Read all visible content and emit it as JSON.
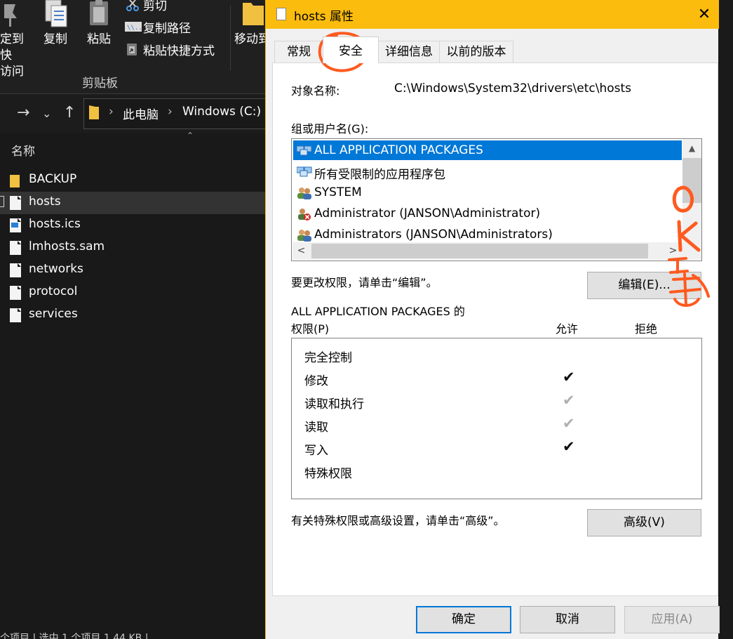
{
  "explorer": {
    "ribbon": {
      "pin_label": "定到快\n访问",
      "copy_label": "复制",
      "paste_label": "粘贴",
      "cut_label": "剪切",
      "copy_path_label": "复制路径",
      "paste_shortcut_label": "粘贴快捷方式",
      "move_label": "移动到",
      "group_label": "剪贴板"
    },
    "breadcrumb": [
      "此电脑",
      "Windows (C:)"
    ],
    "column_header": "名称",
    "files": [
      {
        "name": "BACKUP",
        "type": "folder"
      },
      {
        "name": "hosts",
        "type": "file",
        "selected": true
      },
      {
        "name": "hosts.ics",
        "type": "ics"
      },
      {
        "name": "lmhosts.sam",
        "type": "file"
      },
      {
        "name": "networks",
        "type": "file"
      },
      {
        "name": "protocol",
        "type": "file"
      },
      {
        "name": "services",
        "type": "file"
      }
    ],
    "status": "个项目  |  选中 1 个项目  1.44 KB  |"
  },
  "dialog": {
    "title": "hosts 属性",
    "close_label": "✕",
    "tabs": [
      "常规",
      "安全",
      "详细信息",
      "以前的版本"
    ],
    "active_tab": "安全",
    "object_name_label": "对象名称:",
    "object_name_value": "C:\\Windows\\System32\\drivers\\etc\\hosts",
    "groups_label": "组或用户名(G):",
    "groups": [
      {
        "name": "ALL APPLICATION PACKAGES",
        "icon": "app-packages-icon",
        "selected": true
      },
      {
        "name": "所有受限制的应用程序包",
        "icon": "app-packages-icon"
      },
      {
        "name": "SYSTEM",
        "icon": "users-group-icon"
      },
      {
        "name": "Administrator (JANSON\\Administrator)",
        "icon": "user-disabled-icon"
      },
      {
        "name": "Administrators (JANSON\\Administrators)",
        "icon": "users-group-icon"
      }
    ],
    "edit_hint": "要更改权限，请单击“编辑”。",
    "edit_button": "编辑(E)...",
    "perm_title_line1": "ALL APPLICATION PACKAGES 的",
    "perm_title_line2": "权限(P)",
    "allow_header": "允许",
    "deny_header": "拒绝",
    "permissions": [
      {
        "name": "完全控制",
        "allow": "none"
      },
      {
        "name": "修改",
        "allow": "checked"
      },
      {
        "name": "读取和执行",
        "allow": "grey"
      },
      {
        "name": "读取",
        "allow": "grey"
      },
      {
        "name": "写入",
        "allow": "checked"
      },
      {
        "name": "特殊权限",
        "allow": "none"
      }
    ],
    "advanced_hint": "有关特殊权限或高级设置，请单击“高级”。",
    "advanced_button": "高级(V)",
    "ok_button": "确定",
    "cancel_button": "取消",
    "apply_button": "应用(A)"
  },
  "annotation": {
    "text": "OK 点击",
    "color": "#ff5a1f"
  },
  "colors": {
    "title_bar": "#fbbc0d",
    "selection": "#0078d7",
    "explorer_bg": "#191919"
  }
}
